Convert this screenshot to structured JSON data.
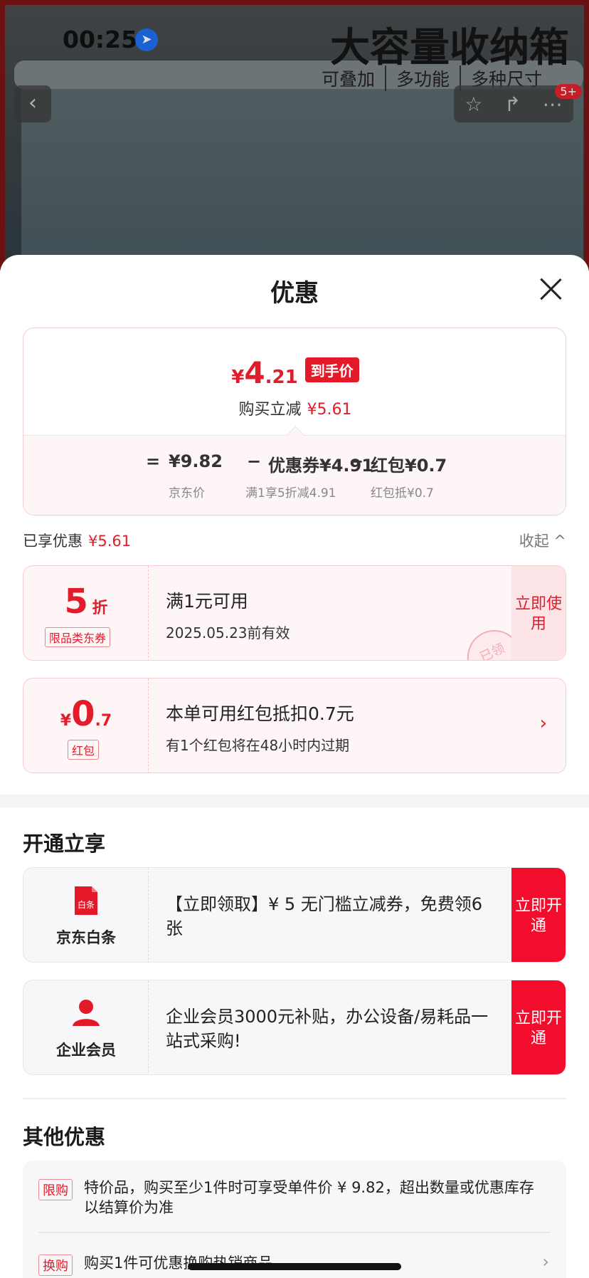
{
  "status_bar": {
    "time": "00:25"
  },
  "banner": {
    "title": "大容量收纳箱",
    "tags": [
      "可叠加",
      "多功能",
      "多种尺寸"
    ],
    "badge": "5+"
  },
  "sheet": {
    "title": "优惠",
    "price": {
      "yen": "¥",
      "integer": "4",
      "decimal": ".21",
      "tag": "到手价",
      "reduce_label": "购买立减",
      "reduce_value": "¥5.61"
    },
    "formula": {
      "eq": "=",
      "jd_price": "¥9.82",
      "minus1": "−",
      "coupon": "优惠券¥4.91",
      "minus2": "−",
      "redpacket": "红包¥0.7",
      "jd_price_label": "京东价",
      "coupon_label": "满1享5折减4.91",
      "redpacket_label": "红包抵¥0.7"
    },
    "enjoyed": {
      "label": "已享优惠",
      "value": "¥5.61",
      "collapse": "收起 ^"
    },
    "coupon1": {
      "value": "5",
      "unit": "折",
      "tag": "限品类东券",
      "main": "满1元可用",
      "sub": "2025.05.23前有效",
      "action": "立即使用",
      "stamp": "已领"
    },
    "coupon2": {
      "yen": "¥",
      "value": "0",
      "decimal": ".7",
      "tag": "红包",
      "main": "本单可用红包抵扣0.7元",
      "sub": "有1个红包将在48小时内过期"
    },
    "open_section": {
      "title": "开通立享",
      "baitiao": {
        "icon_text": "白条",
        "name": "京东白条",
        "text": "【立即领取】¥ 5 无门槛立减券，免费领6张",
        "action": "立即开通"
      },
      "enterprise": {
        "name": "企业会员",
        "text": "企业会员3000元补贴，办公设备/易耗品一站式采购!",
        "action": "立即开通"
      }
    },
    "other_section": {
      "title": "其他优惠",
      "items": [
        {
          "tag": "限购",
          "text": "特价品，购买至少1件时可享受单件价 ¥ 9.82，超出数量或优惠库存以结算价为准"
        },
        {
          "tag": "换购",
          "text": "购买1件可优惠换购热销商品"
        }
      ]
    }
  },
  "colors": {
    "accent": "#e21c2a",
    "cta": "#f20d2d",
    "card_bg": "#fef5f6"
  }
}
